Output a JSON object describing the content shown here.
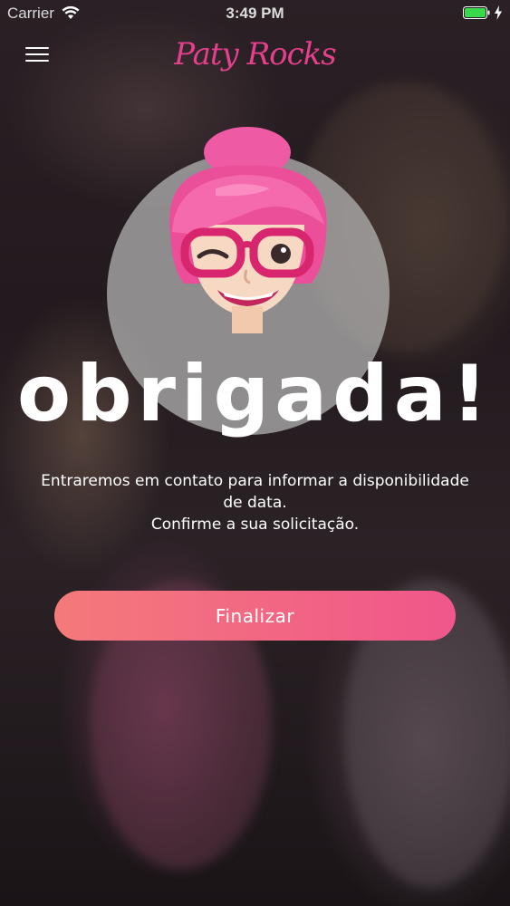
{
  "status_bar": {
    "carrier": "Carrier",
    "time": "3:49 PM",
    "wifi_icon": "wifi-icon",
    "battery_icon": "battery-icon",
    "battery_color": "#38d94a"
  },
  "header": {
    "menu_icon": "hamburger-menu-icon",
    "brand": "Paty Rocks",
    "brand_color": "#e5408c"
  },
  "main": {
    "avatar": "paty-cartoon-avatar",
    "title": "obrigada!",
    "message_lines": [
      "Entraremos em contato para informar a disponibilidade",
      "de data.",
      "Confirme a sua solicitação."
    ],
    "finish_label": "Finalizar",
    "button_gradient": [
      "#f47a7a",
      "#f0568a"
    ]
  }
}
